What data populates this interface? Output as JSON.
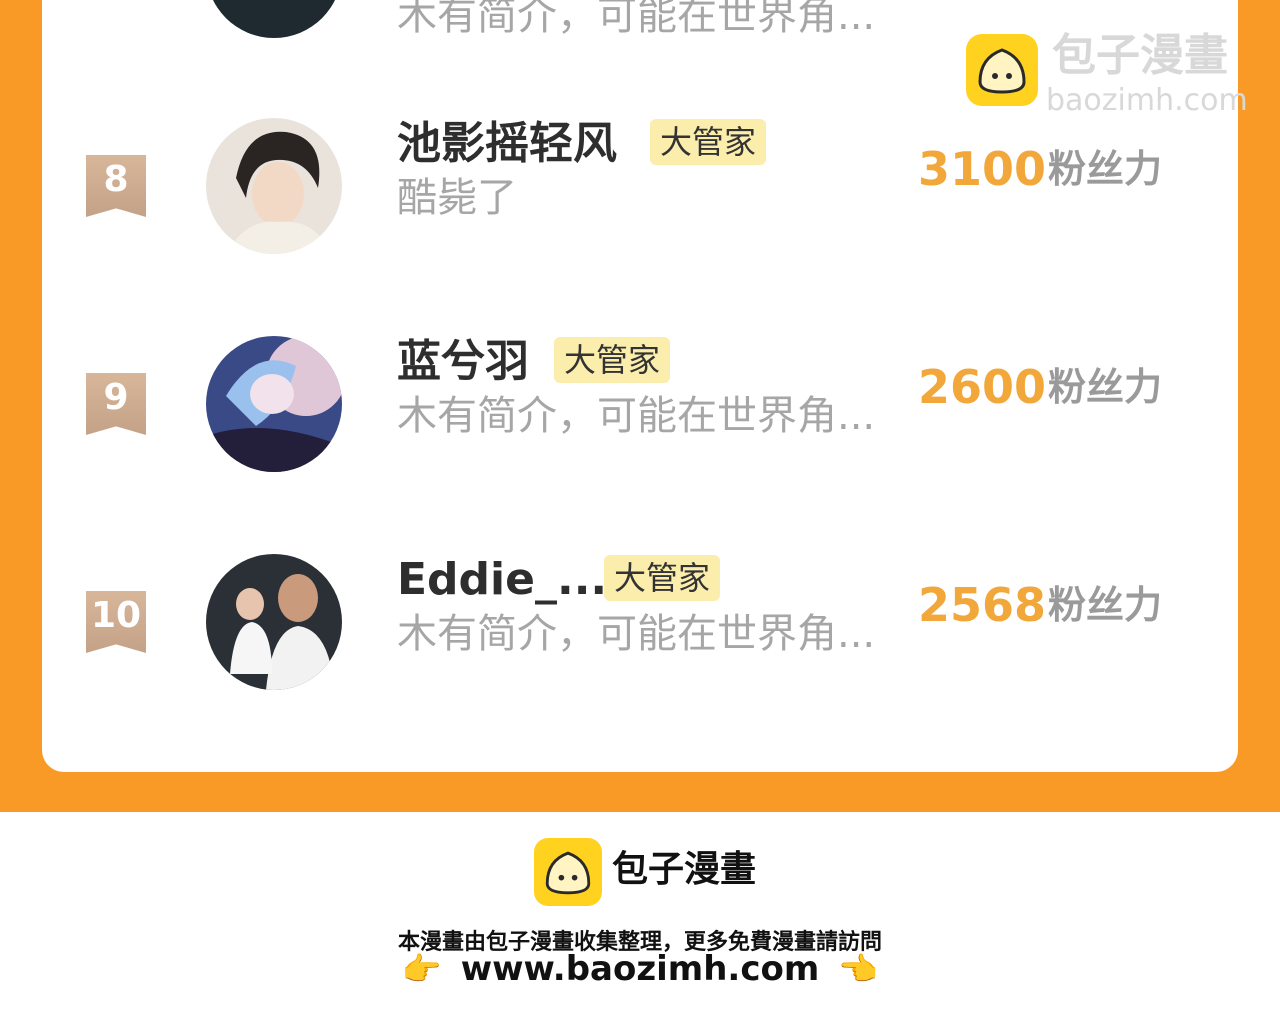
{
  "watermark": {
    "title": "包子漫畫",
    "url": "baozimh.com"
  },
  "rows": [
    {
      "rank": "",
      "name": "",
      "badge": "",
      "bio": "木有简介，可能在世界角...",
      "count": "",
      "fans_label": ""
    },
    {
      "rank": "8",
      "name": "池影摇轻风",
      "badge": "大管家",
      "bio": "酷毙了",
      "count": "3100",
      "fans_label": "粉丝力"
    },
    {
      "rank": "9",
      "name": "蓝兮羽",
      "badge": "大管家",
      "bio": "木有简介，可能在世界角...",
      "count": "2600",
      "fans_label": "粉丝力"
    },
    {
      "rank": "10",
      "name": "Eddie_...",
      "badge": "大管家",
      "bio": "木有简介，可能在世界角...",
      "count": "2568",
      "fans_label": "粉丝力"
    }
  ],
  "footer": {
    "title": "包子漫畫",
    "note": "本漫畫由包子漫畫收集整理，更多免費漫畫請訪問",
    "url": "www.baozimh.com"
  },
  "colors": {
    "accent_orange": "#F99A26",
    "count_color": "#F2A73A",
    "badge_bg": "#FBEDAC",
    "logo_yellow": "#FFD21F"
  }
}
